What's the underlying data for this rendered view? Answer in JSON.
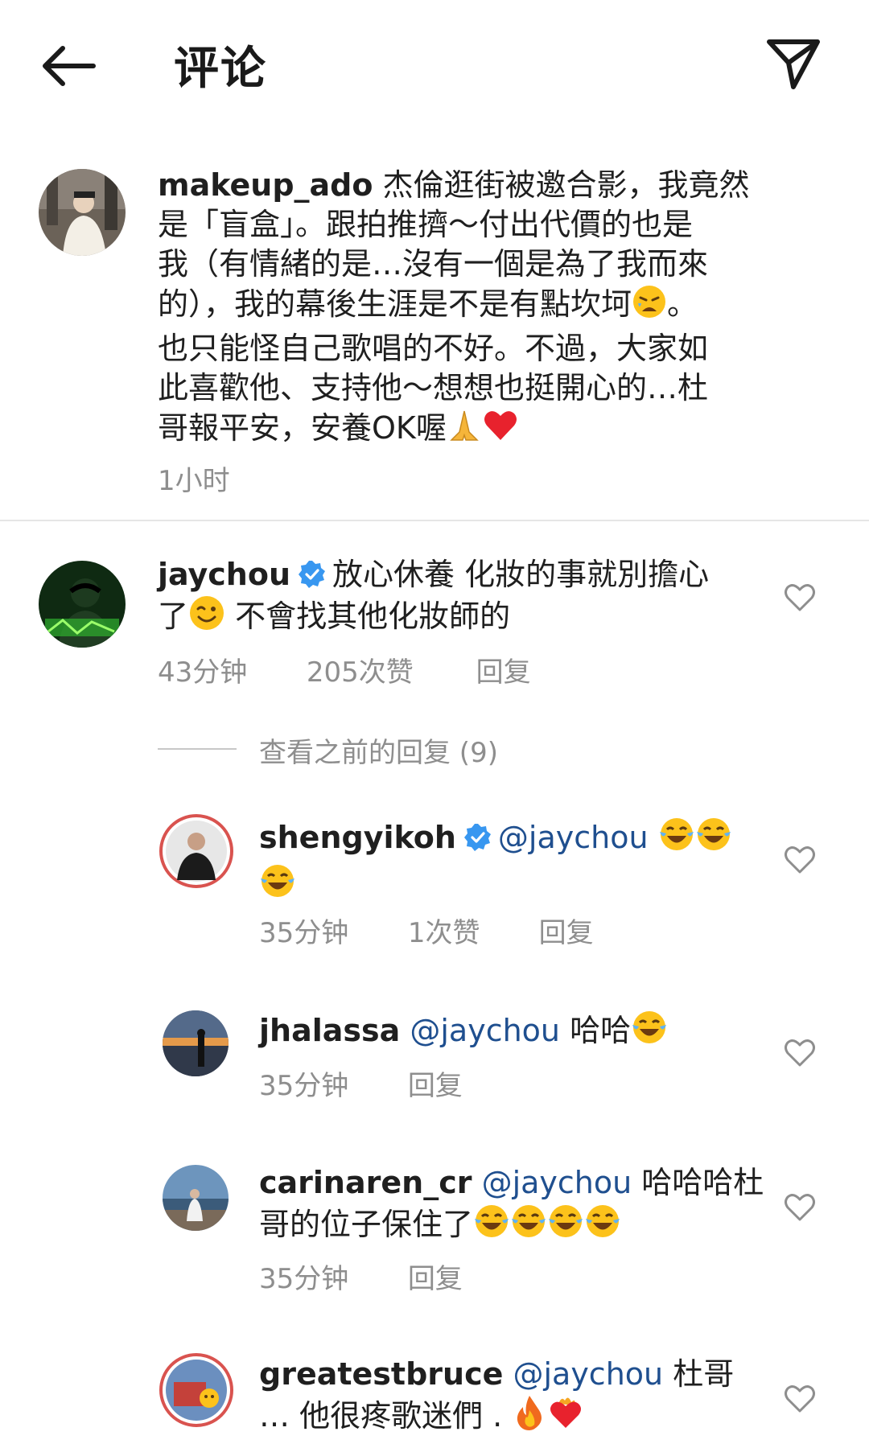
{
  "header": {
    "title": "评论"
  },
  "post": {
    "username": "makeup_ado",
    "text_line1": " 杰倫逛街被邀合影，我竟然",
    "text_line2": "是「盲盒」。跟拍推擠～付出代價的也是",
    "text_line3": "我（有情緒的是…沒有一個是為了我而來",
    "text_line4a": "的），我的幕後生涯是不是有點坎坷",
    "text_line4b": "。",
    "text_line5": "也只能怪自己歌唱的不好。不過，大家如",
    "text_line6": "此喜歡他、支持他～想想也挺開心的…杜",
    "text_line7": "哥報平安，安養OK喔",
    "time": "1小时"
  },
  "comments": [
    {
      "username": "jaychou",
      "text_line1": "放心休養 化妝的事就別擔心",
      "text_line2a": "了",
      "text_line2b": " 不會找其他化妝師的",
      "time": "43分钟",
      "likes": "205次赞",
      "reply": "回复"
    }
  ],
  "view_previous": "查看之前的回复 (9)",
  "replies": [
    {
      "username": "shengyikoh",
      "mention": "@jaychou",
      "time": "35分钟",
      "likes": "1次赞",
      "reply": "回复"
    },
    {
      "username": "jhalassa",
      "mention": "@jaychou",
      "text": " 哈哈",
      "time": "35分钟",
      "reply": "回复"
    },
    {
      "username": "carinaren_cr",
      "mention": "@jaychou",
      "text_line1": " 哈哈哈杜",
      "text_line2": "哥的位子保住了",
      "time": "35分钟",
      "reply": "回复"
    },
    {
      "username": "greatestbruce",
      "mention": "@jaychou",
      "text_line1": " 杜哥",
      "text_line2": "… 他很疼歌迷們 . "
    }
  ],
  "colors": {
    "accent_blue": "#3897f0",
    "mention": "#1f4f8f",
    "meta_gray": "#8e8e8e",
    "divider": "#e6e6e6"
  }
}
